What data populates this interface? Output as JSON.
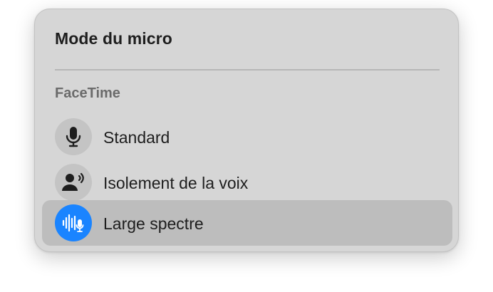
{
  "menu": {
    "title": "Mode du micro",
    "section_label": "FaceTime",
    "items": [
      {
        "label": "Standard",
        "icon": "microphone-icon",
        "selected": false
      },
      {
        "label": "Isolement de la voix",
        "icon": "voice-isolation-icon",
        "selected": false
      },
      {
        "label": "Large spectre",
        "icon": "wide-spectrum-icon",
        "selected": true
      }
    ]
  },
  "colors": {
    "panel_background": "#d6d6d6",
    "selection_background": "#bdbdbd",
    "accent": "#1a84ff",
    "icon_circle": "#c4c4c4"
  }
}
